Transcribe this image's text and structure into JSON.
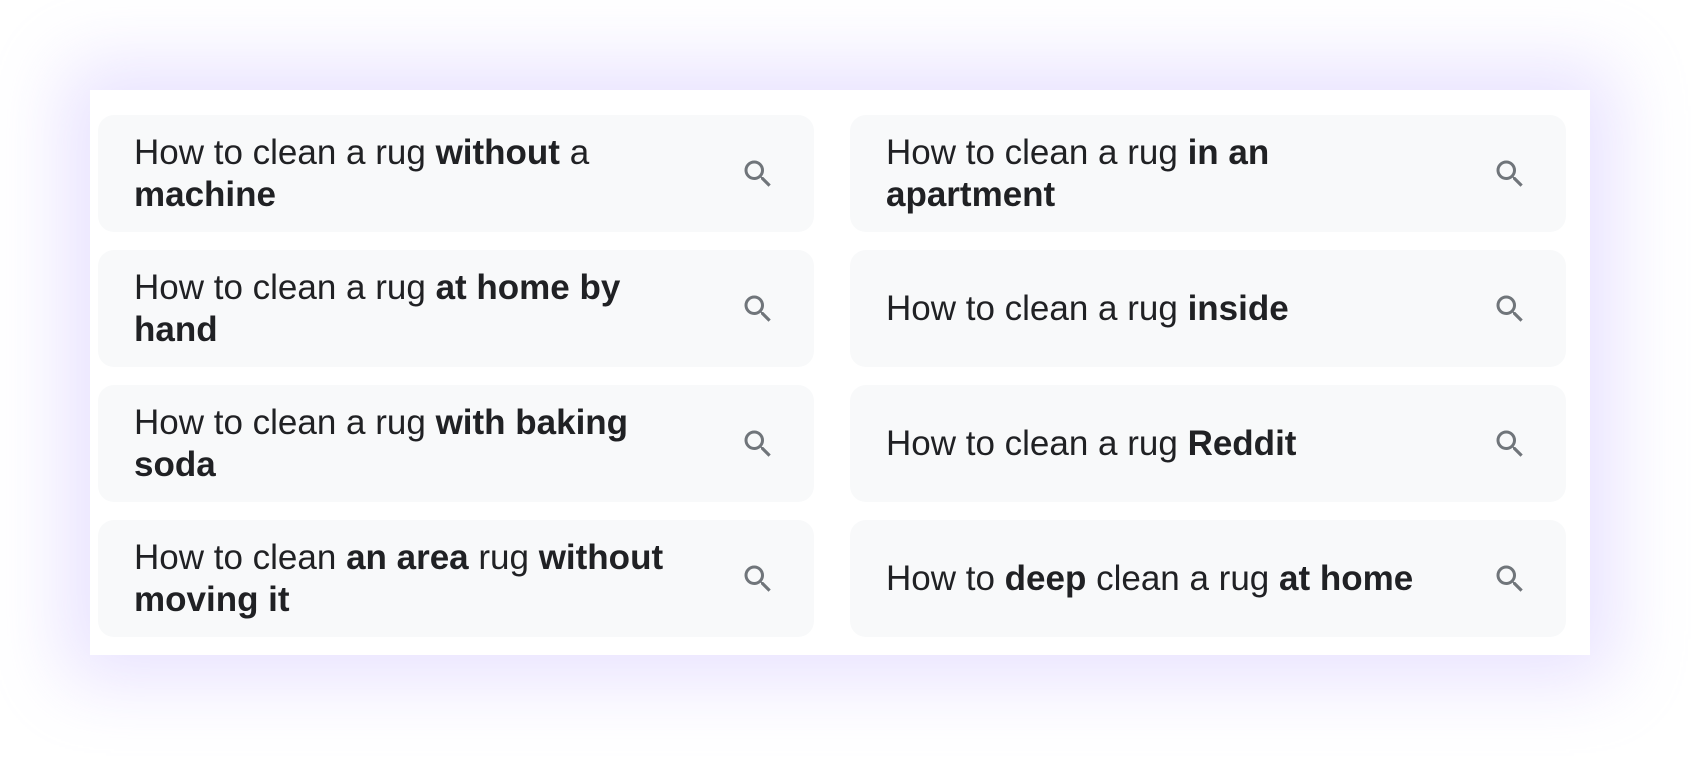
{
  "colors": {
    "card_background": "#f8f9fa",
    "text": "#202124",
    "icon": "#70757a",
    "glow": "#cdbeff"
  },
  "related_searches": [
    {
      "parts": [
        {
          "text": "How to clean a rug ",
          "bold": false
        },
        {
          "text": "without",
          "bold": true
        },
        {
          "text": " a ",
          "bold": false
        },
        {
          "text": "machine",
          "bold": true
        }
      ],
      "icon": "search-icon"
    },
    {
      "parts": [
        {
          "text": "How to clean a rug ",
          "bold": false
        },
        {
          "text": "in an apartment",
          "bold": true
        }
      ],
      "icon": "search-icon"
    },
    {
      "parts": [
        {
          "text": "How to clean a rug ",
          "bold": false
        },
        {
          "text": "at home by hand",
          "bold": true
        }
      ],
      "icon": "search-icon"
    },
    {
      "parts": [
        {
          "text": "How to clean a rug ",
          "bold": false
        },
        {
          "text": "inside",
          "bold": true
        }
      ],
      "icon": "search-icon"
    },
    {
      "parts": [
        {
          "text": "How to clean a rug ",
          "bold": false
        },
        {
          "text": "with baking soda",
          "bold": true
        }
      ],
      "icon": "search-icon"
    },
    {
      "parts": [
        {
          "text": "How to clean a rug ",
          "bold": false
        },
        {
          "text": "Reddit",
          "bold": true
        }
      ],
      "icon": "search-icon"
    },
    {
      "parts": [
        {
          "text": "How to clean ",
          "bold": false
        },
        {
          "text": "an area",
          "bold": true
        },
        {
          "text": " rug ",
          "bold": false
        },
        {
          "text": "without moving it",
          "bold": true
        }
      ],
      "icon": "search-icon"
    },
    {
      "parts": [
        {
          "text": "How to ",
          "bold": false
        },
        {
          "text": "deep",
          "bold": true
        },
        {
          "text": " clean a rug ",
          "bold": false
        },
        {
          "text": "at home",
          "bold": true
        }
      ],
      "icon": "search-icon"
    }
  ]
}
